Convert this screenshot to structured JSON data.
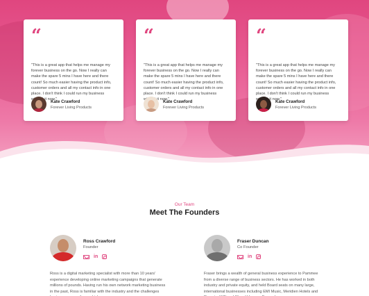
{
  "testimonials": [
    {
      "quote": "\"This is a great app that helps me manage my forever business on the go. Now I really can make the spare 5 mins I have here and there count! So much easier having the product info, customer orders and all my contact info in one place. I don't think I could run my business without it now.\"",
      "name": "Kate Crawford",
      "company": "Forever Living Products"
    },
    {
      "quote": "\"This is a great app that helps me manage my forever business on the go. Now I really can make the spare 5 mins I have here and there count! So much easier having the product info, customer orders and all my contact info in one place. I don't think I could run my business without it now.\"",
      "name": "Kate Crawford",
      "company": "Forever Living Products"
    },
    {
      "quote": "\"This is a great app that helps me manage my forever business on the go. Now I really can make the spare 5 mins I have here and there count! So much easier having the product info, customer orders and all my contact info in one place. I don't think I could run my business without it now.\"",
      "name": "Kate Crawford",
      "company": "Forever Living Products"
    }
  ],
  "quote_glyph": "“",
  "team": {
    "eyebrow": "Our Team",
    "title": "Meet The Founders"
  },
  "founders": [
    {
      "name": "Ross Crawford",
      "role": "Founder",
      "bio": "Ross is a digital marketing specialist with more than 10 years' experience developing online marketing campaigns that generate millions of pounds. Having run his own network marketing business in the past, Ross is familiar with the industry and the challenges business owners face, which"
    },
    {
      "name": "Fraser Duncan",
      "role": "Co Founder",
      "bio": "Fraser brings a wealth of general business experience to Pammee from a diverse range of business sectors. He has worked in both industry and private equity, and held Board seats on many large, international businesses including EMI Music, Meridien Hotels and Resorts, William Hill and Vonova. Fraser has"
    }
  ],
  "social_labels": {
    "linkedin": "in"
  },
  "colors": {
    "accent": "#e0467f",
    "hero_top": "#e0467f",
    "hero_bottom": "#f6a9c6"
  }
}
